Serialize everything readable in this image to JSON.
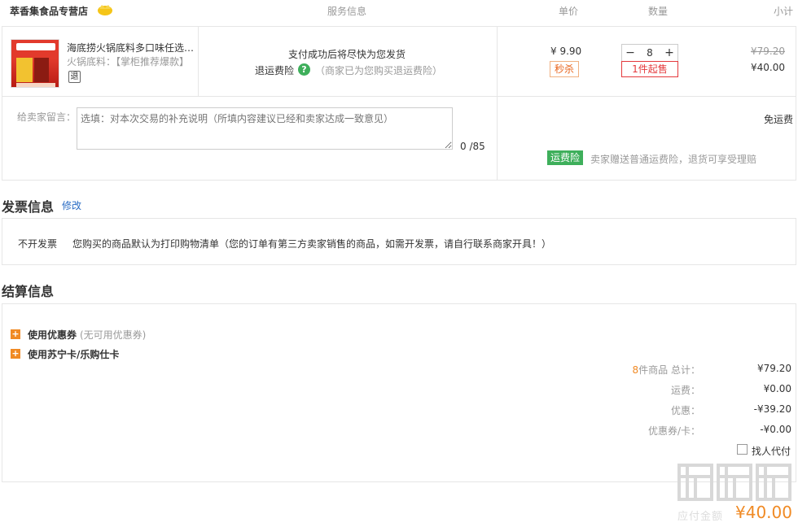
{
  "header": {
    "store_name": "萃香集食品专营店",
    "columns": {
      "service": "服务信息",
      "unit_price": "单价",
      "quantity": "数量",
      "subtotal": "小计"
    }
  },
  "product": {
    "title": "海底捞火锅底料多口味任选套装",
    "subtitle": "火锅底料：【掌柜推荐爆款】",
    "guarantee_icon_text": "退",
    "service_text": "支付成功后将尽快为您发货",
    "service_insurance": "退运费险",
    "service_insurance_note": "（商家已为您购买退运费险）",
    "price": "¥ 9.90",
    "flash_tag": "秒杀",
    "quantity": "8",
    "min_purchase": "1件起售",
    "original_price": "¥79.20",
    "subtotal": "¥40.00"
  },
  "message": {
    "label": "给卖家留言：",
    "placeholder": "选填：对本次交易的补充说明（所填内容建议已经和卖家达成一致意见）",
    "count": "0 /85",
    "shipping": "免运费",
    "insurance_tag": "运费险",
    "insurance_note": "卖家赠送普通运费险，退货可享受理赔"
  },
  "invoice": {
    "title": "发票信息",
    "modify": "修改",
    "type": "不开发票",
    "note": "您购买的商品默认为打印购物清单（您的订单有第三方卖家销售的商品，如需开发票，请自行联系商家开具！）"
  },
  "settlement": {
    "title": "结算信息",
    "coupon_label": "使用优惠券",
    "coupon_note": "(无可用优惠券)",
    "card_label": "使用苏宁卡/乐购仕卡",
    "count": "8",
    "count_suffix": "件商品 总计：",
    "total": "¥79.20",
    "shipping_label": "运费：",
    "shipping_value": "¥0.00",
    "discount_label": "优惠：",
    "discount_value": "-¥39.20",
    "card_discount_label": "优惠券/卡：",
    "card_discount_value": "-¥0.00",
    "proxy_pay": "找人代付"
  },
  "footer": {
    "watermark_text": "应付金额",
    "pay_amount": "¥40.00"
  }
}
